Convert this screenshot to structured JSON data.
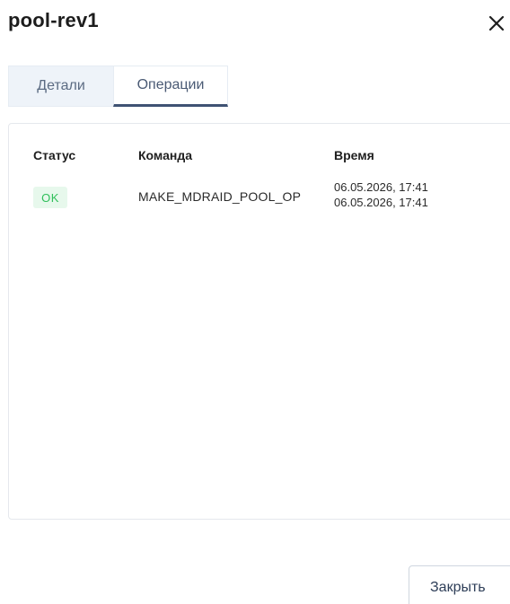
{
  "dialog": {
    "title": "pool-rev1",
    "close_icon": "close-icon"
  },
  "tabs": [
    {
      "label": "Детали",
      "active": false
    },
    {
      "label": "Операции",
      "active": true
    }
  ],
  "table": {
    "headers": {
      "status": "Статус",
      "command": "Команда",
      "time": "Время"
    },
    "rows": [
      {
        "status": "OK",
        "command": "MAKE_MDRAID_POOL_OP",
        "time_start": "06.05.2026, 17:41",
        "time_end": "06.05.2026, 17:41"
      }
    ]
  },
  "footer": {
    "close_label": "Закрыть"
  },
  "colors": {
    "accent": "#3f5273",
    "status_ok_text": "#2fbf5a",
    "status_ok_bg": "#e7f8ec",
    "tab_inactive_bg": "#eef3f9"
  }
}
